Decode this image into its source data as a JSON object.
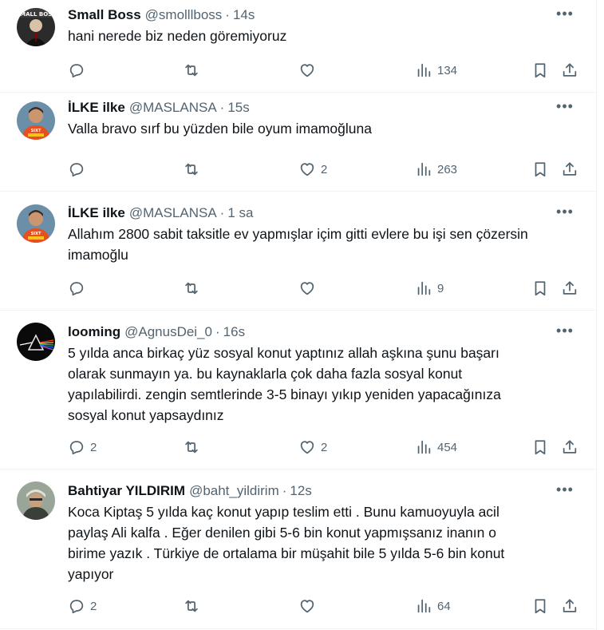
{
  "tweets": [
    {
      "name": "Small Boss",
      "handle": "@smolllboss",
      "time": "14s",
      "text": "hani nerede biz neden göremiyoruz",
      "replies": "",
      "retweets": "",
      "likes": "",
      "views": "134",
      "avatar": "small-boss-avatar"
    },
    {
      "name": "İLKE ilke",
      "handle": "@MASLANSA",
      "time": "15s",
      "text": "Valla bravo sırf bu yüzden bile oyum imamoğluna",
      "replies": "",
      "retweets": "",
      "likes": "2",
      "views": "263",
      "avatar": "ilke-avatar"
    },
    {
      "name": "İLKE ilke",
      "handle": "@MASLANSA",
      "time": "1 sa",
      "text": "Allahım 2800 sabit taksitle ev yapmışlar içim gitti evlere bu işi sen çözersin\nimamoğlu",
      "replies": "",
      "retweets": "",
      "likes": "",
      "views": "9",
      "avatar": "ilke-avatar"
    },
    {
      "name": "looming",
      "handle": "@AgnusDei_0",
      "time": "16s",
      "text": "5 yılda anca birkaç yüz sosyal konut yaptınız allah aşkına şunu başarı\nolarak sunmayın ya. bu kaynaklarla çok daha fazla sosyal konut\nyapılabilirdi. zengin semtlerinde 3-5 binayı yıkıp yeniden yapacağınıza\nsosyal konut yapsaydınız",
      "replies": "2",
      "retweets": "",
      "likes": "2",
      "views": "454",
      "avatar": "prism-avatar"
    },
    {
      "name": "Bahtiyar YILDIRIM",
      "handle": "@baht_yildirim",
      "time": "12s",
      "text": "Koca Kiptaş 5 yılda kaç konut yapıp teslim etti . Bunu kamuoyuyla acil\npaylaş Ali kalfa . Eğer denilen gibi 5-6 bin konut yapmışsanız inanın o\nbirime yazık . Türkiye de ortalama bir müşahit bile 5 yılda 5-6 bin konut\nyapıyor",
      "replies": "2",
      "retweets": "",
      "likes": "",
      "views": "64",
      "avatar": "bahtiyar-avatar"
    }
  ],
  "ui": {
    "more_label": "•••",
    "dot": "·"
  }
}
